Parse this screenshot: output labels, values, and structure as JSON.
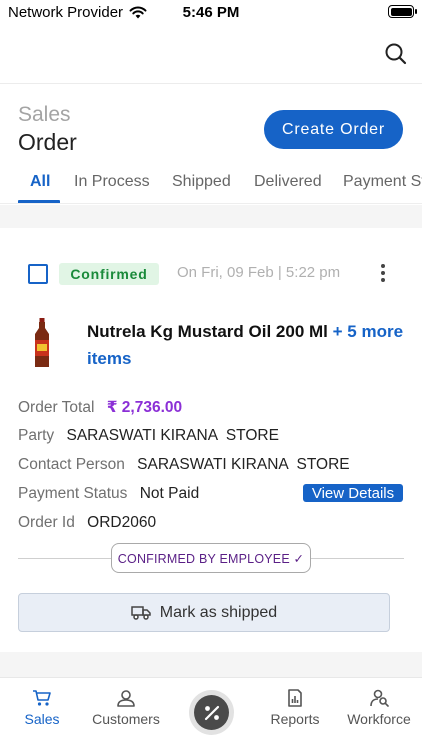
{
  "status_bar": {
    "carrier": "Network Provider",
    "time": "5:46 PM"
  },
  "header": {
    "title_sub": "Sales",
    "title_main": "Order",
    "create_button": "Create Order"
  },
  "tabs": [
    {
      "label": "All",
      "active": true
    },
    {
      "label": "In Process",
      "active": false
    },
    {
      "label": "Shipped",
      "active": false
    },
    {
      "label": "Delivered",
      "active": false
    },
    {
      "label": "Payment Status",
      "active": false
    }
  ],
  "order": {
    "status": "Confirmed",
    "date": "On Fri, 09 Feb | 5:22 pm",
    "product_name": "Nutrela Kg Mustard Oil 200 Ml",
    "more_items": "+ 5 more items",
    "fields": {
      "order_total_label": "Order Total",
      "order_total_value": "₹ 2,736.00",
      "party_label": "Party",
      "party_value": "SARASWATI KIRANA  STORE",
      "contact_label": "Contact Person",
      "contact_value": "SARASWATI KIRANA  STORE",
      "payment_label": "Payment Status",
      "payment_value": "Not Paid",
      "order_id_label": "Order Id",
      "order_id_value": "ORD2060"
    },
    "view_details": "View Details",
    "confirmed_by": "CONFIRMED BY EMPLOYEE ✓",
    "ship_button": "Mark as shipped"
  },
  "bottom_nav": [
    {
      "label": "Sales",
      "icon": "cart-icon",
      "active": true
    },
    {
      "label": "Customers",
      "icon": "user-icon",
      "active": false
    },
    {
      "label": "",
      "icon": "percent-icon",
      "active": false
    },
    {
      "label": "Reports",
      "icon": "report-icon",
      "active": false
    },
    {
      "label": "Workforce",
      "icon": "workforce-icon",
      "active": false
    }
  ],
  "colors": {
    "primary": "#1663c7",
    "confirmed_bg": "#e1f5e5",
    "confirmed_text": "#1a8a3a",
    "amount": "#8b2fd6"
  }
}
